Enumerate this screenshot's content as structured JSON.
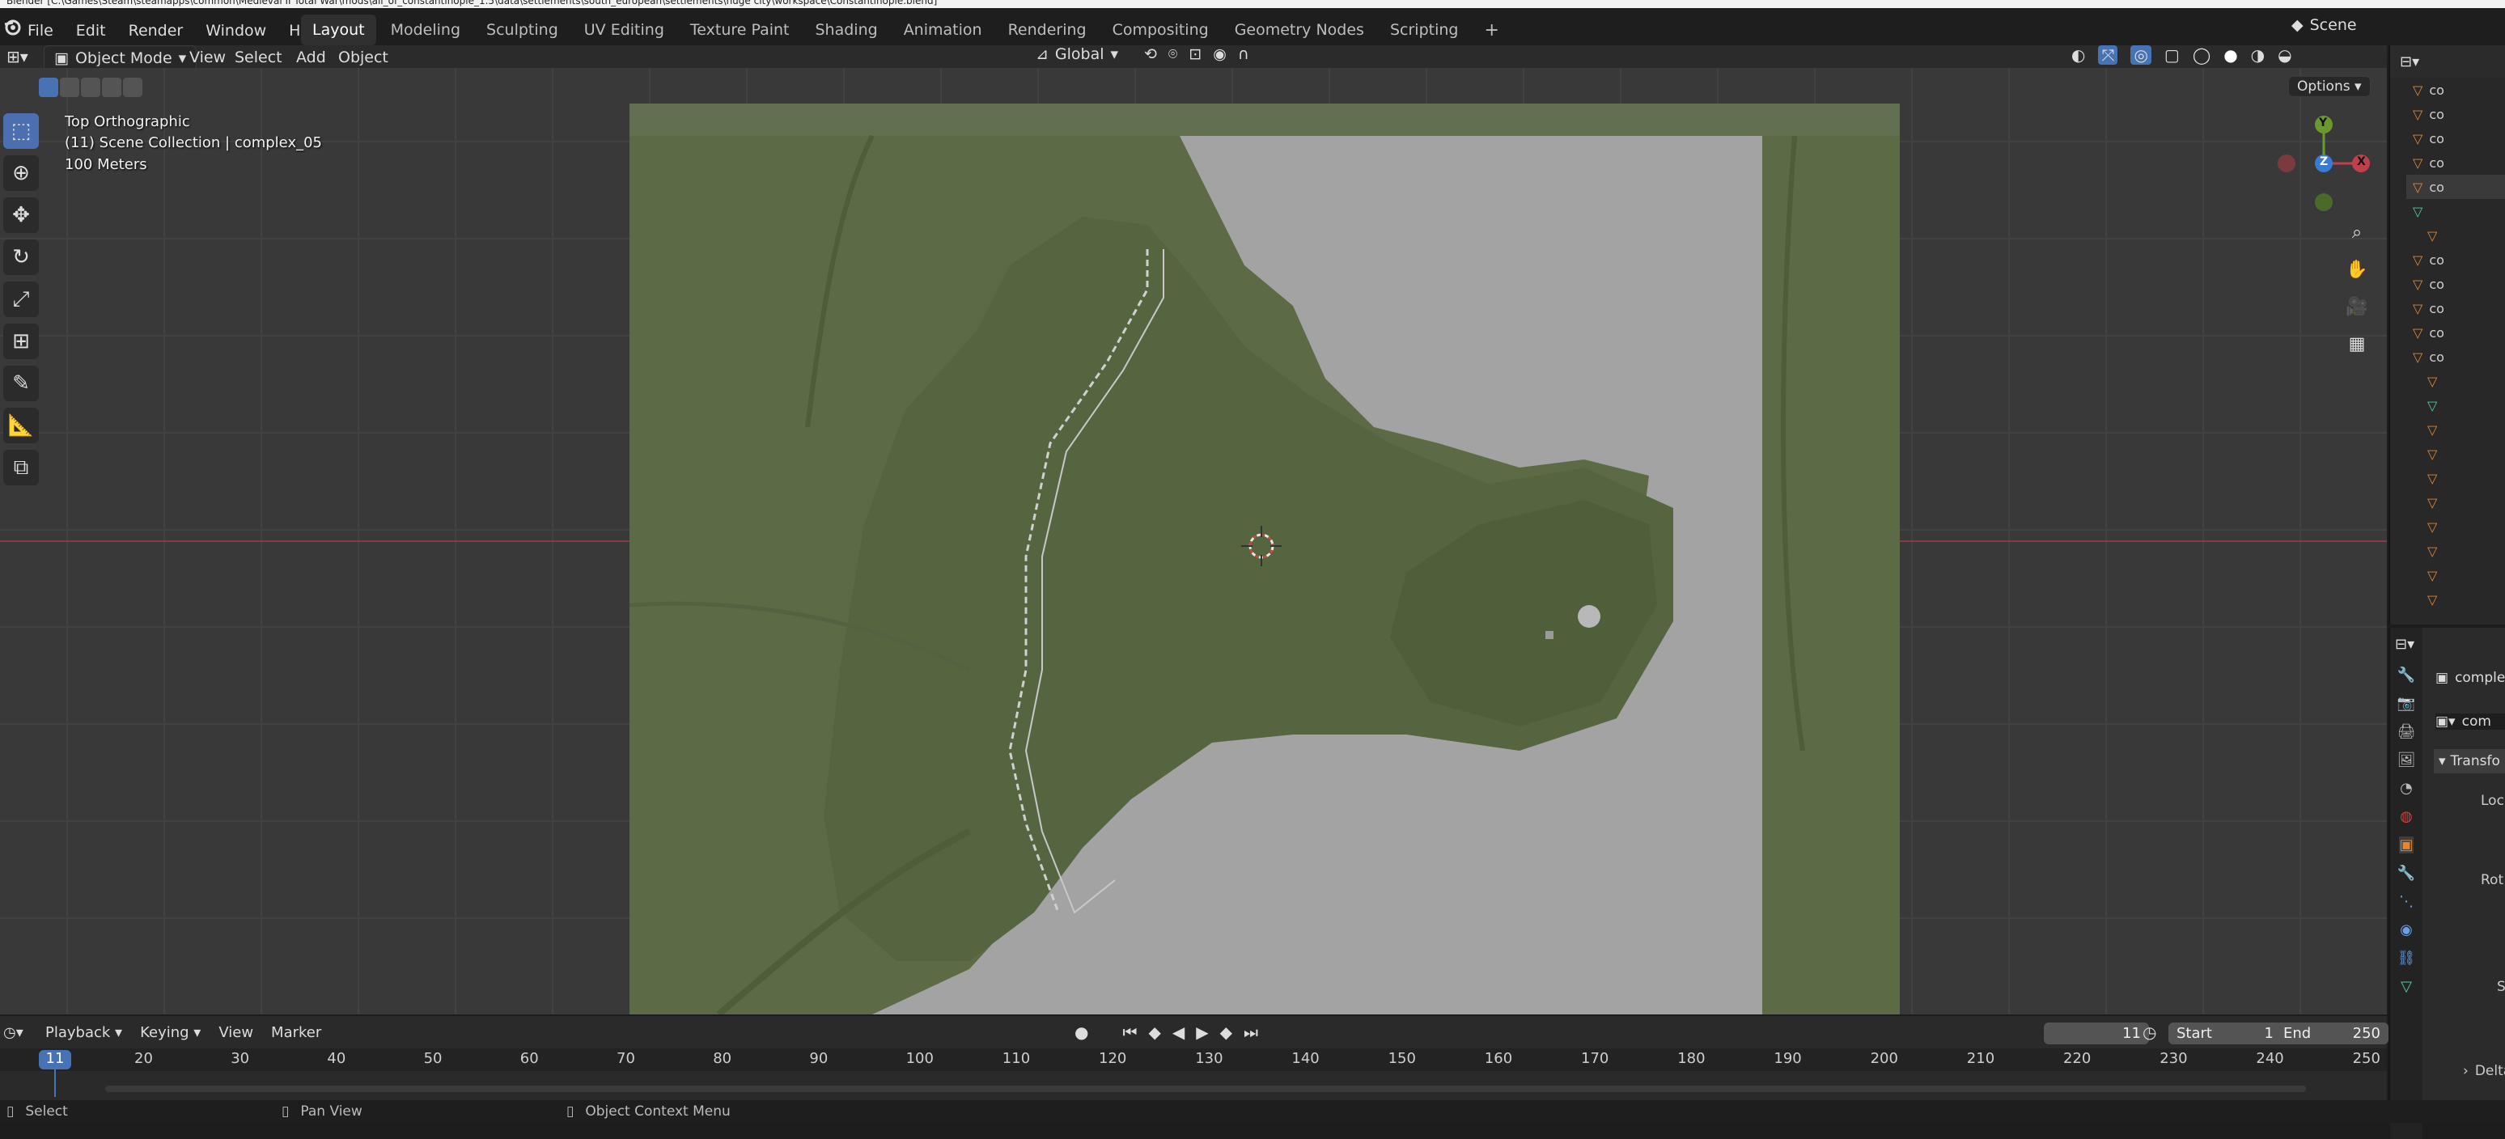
{
  "window": {
    "title": "Blender [C:\\Games\\Steam\\steamapps\\common\\Medieval II Total War\\mods\\all_of_constantinople_1.5\\data\\settlements\\south_european\\settlements\\huge city\\workspace\\Constantinople.blend]"
  },
  "menu": [
    "File",
    "Edit",
    "Render",
    "Window",
    "Help"
  ],
  "workspaces": [
    {
      "label": "Layout",
      "active": true
    },
    {
      "label": "Modeling",
      "active": false
    },
    {
      "label": "Sculpting",
      "active": false
    },
    {
      "label": "UV Editing",
      "active": false
    },
    {
      "label": "Texture Paint",
      "active": false
    },
    {
      "label": "Shading",
      "active": false
    },
    {
      "label": "Animation",
      "active": false
    },
    {
      "label": "Rendering",
      "active": false
    },
    {
      "label": "Compositing",
      "active": false
    },
    {
      "label": "Geometry Nodes",
      "active": false
    },
    {
      "label": "Scripting",
      "active": false
    }
  ],
  "scene": {
    "label": "Scene"
  },
  "viewport_header": {
    "mode": "Object Mode",
    "menus": [
      "View",
      "Select",
      "Add",
      "Object"
    ],
    "orientation": "Global",
    "options": "Options"
  },
  "overlay": {
    "view_name": "Top Orthographic",
    "collection": "(11) Scene Collection | complex_05",
    "scale": "100 Meters"
  },
  "gizmo": {
    "x": "X",
    "y": "Y",
    "z": "Z"
  },
  "outliner": {
    "rows": [
      "co",
      "co",
      "co",
      "co",
      "co",
      "",
      "",
      "co",
      "co",
      "co",
      "co",
      "co",
      "",
      "",
      "",
      "",
      "",
      "",
      "",
      "",
      "",
      ""
    ]
  },
  "properties": {
    "object_name": "comple",
    "data_name": "com",
    "transform": "Transfo",
    "location": "Loc",
    "rotation": "Rot",
    "scale_abbrev": "S",
    "delta": "Delta"
  },
  "timeline": {
    "menus": [
      "Playback",
      "Keying",
      "View",
      "Marker"
    ],
    "current_frame": "11",
    "start_label": "Start",
    "start": "1",
    "end_label": "End",
    "end": "250",
    "ticks": [
      "20",
      "30",
      "40",
      "50",
      "60",
      "70",
      "80",
      "90",
      "100",
      "110",
      "120",
      "130",
      "140",
      "150",
      "160",
      "170",
      "180",
      "190",
      "200",
      "210",
      "220",
      "230",
      "240",
      "250"
    ]
  },
  "status": {
    "select": "Select",
    "pan": "Pan View",
    "context": "Object Context Menu"
  },
  "colors": {
    "accent": "#4772b3",
    "terrain": "#5c6b45",
    "water": "#a3a3a3",
    "viewport_bg": "#393939"
  }
}
